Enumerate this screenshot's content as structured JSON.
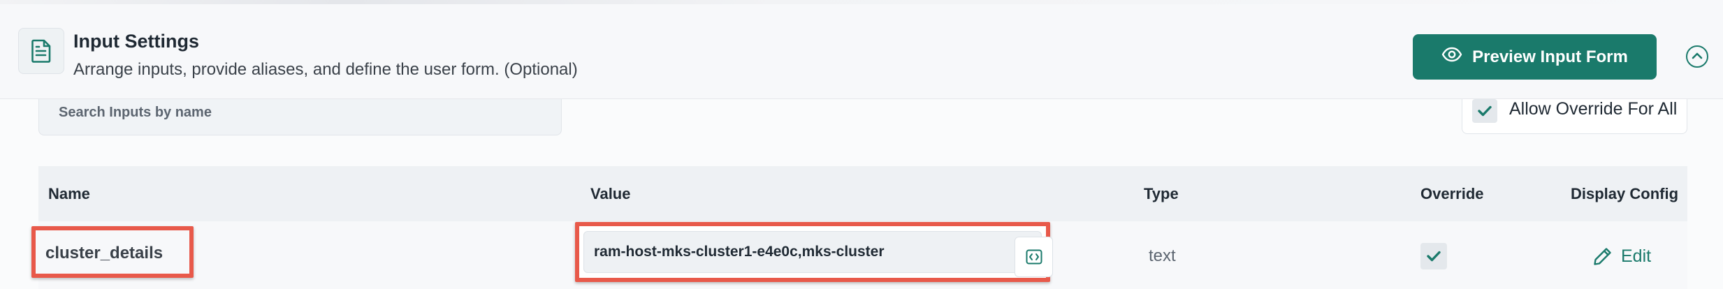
{
  "header": {
    "title": "Input Settings",
    "subtitle": "Arrange inputs, provide aliases, and define the user form. (Optional)",
    "preview_button": "Preview Input Form"
  },
  "search": {
    "placeholder": "Search Inputs by name"
  },
  "allow_override": {
    "label": "Allow Override For All",
    "checked": true
  },
  "table": {
    "columns": [
      "Name",
      "Value",
      "Type",
      "Override",
      "Display Config"
    ],
    "rows": [
      {
        "name": "cluster_details",
        "value": "ram-host-mks-cluster1-e4e0c,mks-cluster",
        "type": "text",
        "override": true,
        "display_config": "Edit"
      }
    ]
  },
  "colors": {
    "accent": "#1a7a6b",
    "highlight": "#e8594a"
  },
  "icons": {
    "header": "document-icon",
    "preview": "eye-icon",
    "collapse": "chevron-up-icon",
    "code": "code-icon",
    "check": "checkmark-icon",
    "edit": "pencil-icon"
  }
}
